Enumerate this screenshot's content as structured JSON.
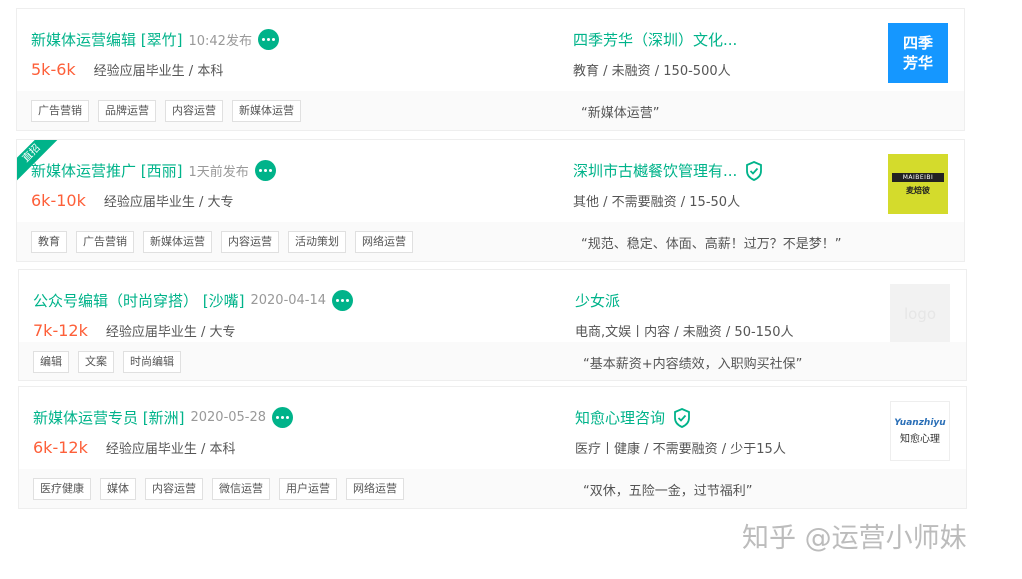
{
  "jobs": [
    {
      "title": "新媒体运营编辑 [翠竹]",
      "time": "10:42发布",
      "salary": "5k-6k",
      "req": "经验应届毕业生 / 本科",
      "company": "四季芳华（深圳）文化...",
      "verified": false,
      "meta": "教育 / 未融资 / 150-500人",
      "logo": {
        "style": "blue",
        "line1": "四季",
        "line2": "芳华"
      },
      "tags": [
        "广告营销",
        "品牌运营",
        "内容运营",
        "新媒体运营"
      ],
      "quote": "“新媒体运营”"
    },
    {
      "badge": "直招",
      "title": "新媒体运营推广 [西丽]",
      "time": "1天前发布",
      "salary": "6k-10k",
      "req": "经验应届毕业生 / 大专",
      "company": "深圳市古樾餐饮管理有...",
      "verified": true,
      "meta": "其他 / 不需要融资 / 15-50人",
      "logo": {
        "style": "yellow",
        "line1": "MAIBEIBI",
        "line2": "麦焙彼"
      },
      "tags": [
        "教育",
        "广告营销",
        "新媒体运营",
        "内容运营",
        "活动策划",
        "网络运营"
      ],
      "quote": "“规范、稳定、体面、高薪！过万？不是梦！”"
    },
    {
      "title": "公众号编辑（时尚穿搭） [沙嘴]",
      "time": "2020-04-14",
      "salary": "7k-12k",
      "req": "经验应届毕业生 / 大专",
      "company": "少女派",
      "verified": false,
      "meta": "电商,文娱丨内容 / 未融资 / 50-150人",
      "logo": {
        "style": "gray",
        "line1": "logo",
        "line2": ""
      },
      "tags": [
        "编辑",
        "文案",
        "时尚编辑"
      ],
      "quote": "“基本薪资+内容绩效，入职购买社保”"
    },
    {
      "title": "新媒体运营专员 [新洲]",
      "time": "2020-05-28",
      "salary": "6k-12k",
      "req": "经验应届毕业生 / 本科",
      "company": "知愈心理咨询",
      "verified": true,
      "meta": "医疗丨健康 / 不需要融资 / 少于15人",
      "logo": {
        "style": "white",
        "line1": "Yuanzhiyu",
        "line2": "知愈心理"
      },
      "tags": [
        "医疗健康",
        "媒体",
        "内容运营",
        "微信运营",
        "用户运营",
        "网络运营"
      ],
      "quote": "“双休，五险一金，过节福利”"
    }
  ],
  "watermark": "知乎 @运营小师妹",
  "colors": {
    "accent": "#00b38a",
    "salary": "#fd5f39",
    "logo_blue": "#1597ff",
    "logo_yellow": "#d4db2c"
  }
}
